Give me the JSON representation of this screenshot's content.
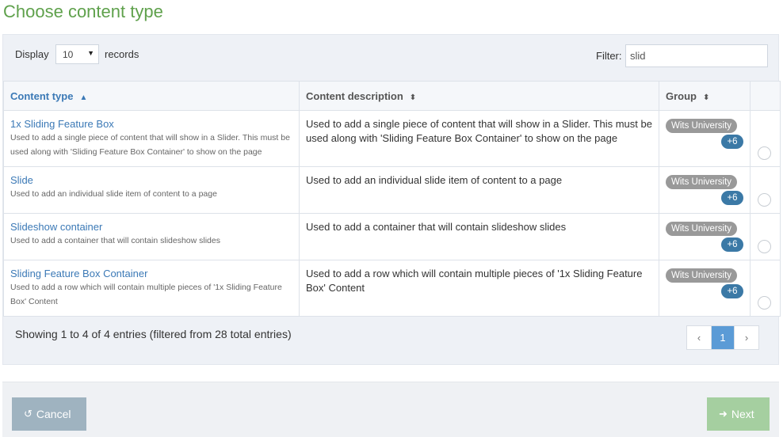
{
  "page": {
    "title": "Choose content type"
  },
  "controls": {
    "display_label": "Display",
    "page_length": "10",
    "records_label": "records",
    "filter_label": "Filter:",
    "filter_value": "slid"
  },
  "table": {
    "columns": [
      {
        "label": "Content type",
        "sort": "asc"
      },
      {
        "label": "Content description",
        "sort": "both"
      },
      {
        "label": "Group",
        "sort": "both"
      }
    ],
    "rows": [
      {
        "name": "1x Sliding Feature Box",
        "short_desc": "Used to add a single piece of content that will show in a Slider. This must be used along with 'Sliding Feature Box Container' to show on the page",
        "description": "Used to add a single piece of content that will show in a Slider. This must be used along with 'Sliding Feature Box Container' to show on the page",
        "group": "Wits University",
        "group_more": "+6"
      },
      {
        "name": "Slide",
        "short_desc": "Used to add an individual slide item of content to a page",
        "description": "Used to add an individual slide item of content to a page",
        "group": "Wits University",
        "group_more": "+6"
      },
      {
        "name": "Slideshow container",
        "short_desc": "Used to add a container that will contain slideshow slides",
        "description": "Used to add a container that will contain slideshow slides",
        "group": "Wits University",
        "group_more": "+6"
      },
      {
        "name": "Sliding Feature Box Container",
        "short_desc": "Used to add a row which will contain multiple pieces of '1x Sliding Feature Box' Content",
        "description": "Used to add a row which will contain multiple pieces of '1x Sliding Feature Box' Content",
        "group": "Wits University",
        "group_more": "+6"
      }
    ]
  },
  "info": {
    "text": "Showing 1 to 4 of 4 entries (filtered from 28 total entries)"
  },
  "pagination": {
    "prev": "‹",
    "current": "1",
    "next": "›"
  },
  "footer": {
    "cancel_label": "Cancel",
    "next_label": "Next"
  },
  "colors": {
    "title": "#5fa14c",
    "link": "#3b79b6",
    "badge_group": "#999999",
    "badge_count": "#3b79a6",
    "cancel_button": "#9fb3c0",
    "next_button": "#a5cfa0"
  },
  "icons": {
    "cancel": "undo-icon",
    "next": "arrow-right-icon"
  }
}
